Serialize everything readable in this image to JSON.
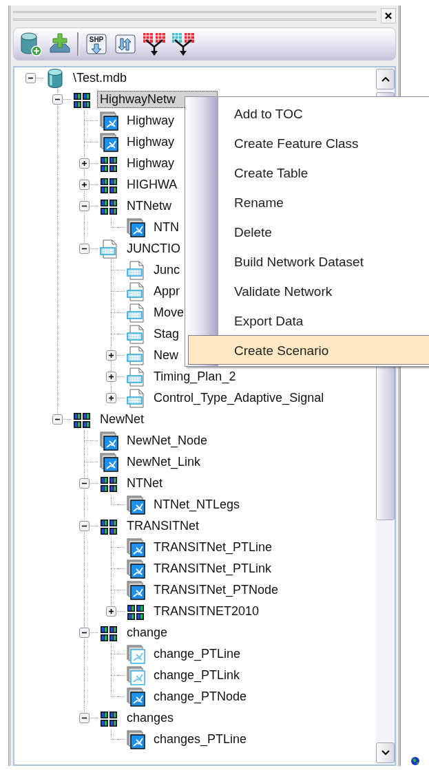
{
  "toolbar": [
    {
      "kind": "database"
    },
    {
      "kind": "add"
    },
    {
      "kind": "separator"
    },
    {
      "kind": "import",
      "label": "SHP"
    },
    {
      "kind": "export"
    },
    {
      "kind": "split"
    },
    {
      "kind": "merge"
    }
  ],
  "tree": [
    {
      "label": "\\Test.mdb",
      "kind": "database",
      "expanded": true,
      "selected": false,
      "children": [
        {
          "label": "HighwayNetw",
          "kind": "network",
          "expanded": true,
          "selected": true,
          "children": [
            {
              "label": "Highway",
              "kind": "featureclass",
              "selected": false
            },
            {
              "label": "Highway",
              "kind": "featureclass",
              "selected": false
            },
            {
              "label": "Highway",
              "kind": "network",
              "expanded": false,
              "selected": false
            },
            {
              "label": "HIGHWA",
              "kind": "network",
              "expanded": false,
              "selected": false
            },
            {
              "label": "NTNetw",
              "kind": "network",
              "expanded": true,
              "selected": false,
              "children": [
                {
                  "label": "NTN",
                  "kind": "featureclass",
                  "selected": false
                }
              ]
            },
            {
              "label": "JUNCTIO",
              "kind": "table",
              "expanded": true,
              "selected": false,
              "children": [
                {
                  "label": "Junc",
                  "kind": "table",
                  "selected": false
                },
                {
                  "label": "Appr",
                  "kind": "table",
                  "selected": false
                },
                {
                  "label": "Move",
                  "kind": "table",
                  "selected": false
                },
                {
                  "label": "Stag",
                  "kind": "table",
                  "selected": false
                },
                {
                  "label": "New",
                  "kind": "table",
                  "expanded": false,
                  "selected": false
                },
                {
                  "label": "Timing_Plan_2",
                  "kind": "table",
                  "expanded": false,
                  "selected": false
                },
                {
                  "label": "Control_Type_Adaptive_Signal",
                  "kind": "table",
                  "expanded": false,
                  "selected": false
                }
              ]
            }
          ]
        },
        {
          "label": "NewNet",
          "kind": "network",
          "expanded": true,
          "selected": false,
          "children": [
            {
              "label": "NewNet_Node",
              "kind": "featureclass",
              "selected": false
            },
            {
              "label": "NewNet_Link",
              "kind": "featureclass",
              "selected": false
            },
            {
              "label": "NTNet",
              "kind": "network",
              "expanded": true,
              "selected": false,
              "children": [
                {
                  "label": "NTNet_NTLegs",
                  "kind": "featureclass",
                  "selected": false
                }
              ]
            },
            {
              "label": "TRANSITNet",
              "kind": "network",
              "expanded": true,
              "selected": false,
              "children": [
                {
                  "label": "TRANSITNet_PTLine",
                  "kind": "featureclass",
                  "selected": false
                },
                {
                  "label": "TRANSITNet_PTLink",
                  "kind": "featureclass",
                  "selected": false
                },
                {
                  "label": "TRANSITNet_PTNode",
                  "kind": "featureclass",
                  "selected": false
                },
                {
                  "label": "TRANSITNET2010",
                  "kind": "network",
                  "expanded": false,
                  "selected": false
                }
              ]
            },
            {
              "label": "change",
              "kind": "network",
              "expanded": true,
              "selected": false,
              "children": [
                {
                  "label": "change_PTLine",
                  "kind": "lightclass",
                  "selected": false
                },
                {
                  "label": "change_PTLink",
                  "kind": "lightclass",
                  "selected": false
                },
                {
                  "label": "change_PTNode",
                  "kind": "featureclass",
                  "selected": false
                }
              ]
            },
            {
              "label": "changes",
              "kind": "network",
              "expanded": true,
              "selected": false,
              "children": [
                {
                  "label": "changes_PTLine",
                  "kind": "featureclass",
                  "selected": false
                }
              ]
            }
          ]
        }
      ]
    }
  ],
  "context_menu": [
    {
      "label": "Add to TOC",
      "selected": false
    },
    {
      "label": "Create Feature Class",
      "selected": false
    },
    {
      "label": "Create Table",
      "selected": false
    },
    {
      "label": "Rename",
      "selected": false
    },
    {
      "label": "Delete",
      "selected": false
    },
    {
      "label": "Build Network Dataset",
      "selected": false
    },
    {
      "label": "Validate Network",
      "selected": false
    },
    {
      "label": "Export Data",
      "selected": false
    },
    {
      "label": "Create Scenario",
      "selected": true
    }
  ]
}
